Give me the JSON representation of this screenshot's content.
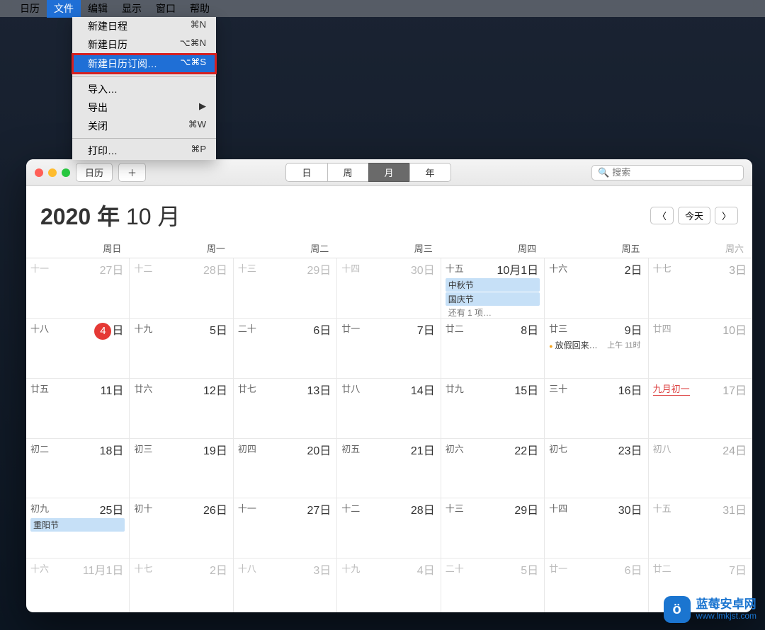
{
  "menubar": {
    "items": [
      "日历",
      "文件",
      "编辑",
      "显示",
      "窗口",
      "帮助"
    ],
    "active_index": 1
  },
  "dropdown": {
    "items": [
      {
        "label": "新建日程",
        "shortcut": "⌘N"
      },
      {
        "label": "新建日历",
        "shortcut": "⌥⌘N"
      },
      {
        "label": "新建日历订阅…",
        "shortcut": "⌥⌘S",
        "highlight": true
      },
      {
        "sep": true
      },
      {
        "label": "导入…",
        "shortcut": ""
      },
      {
        "label": "导出",
        "shortcut": "",
        "submenu": true
      },
      {
        "label": "关闭",
        "shortcut": "⌘W"
      },
      {
        "sep": true
      },
      {
        "label": "打印…",
        "shortcut": "⌘P"
      }
    ]
  },
  "toolbar": {
    "calendars_btn": "日历",
    "add_btn": "＋",
    "views": [
      "日",
      "周",
      "月",
      "年"
    ],
    "view_active": 2,
    "search_placeholder": "搜索"
  },
  "header": {
    "year": "2020 年",
    "month": "10 月",
    "prev": "〈",
    "next": "〉",
    "today": "今天"
  },
  "weekdays": [
    "周日",
    "周一",
    "周二",
    "周三",
    "周四",
    "周五",
    "周六"
  ],
  "cells": [
    {
      "lunar": "十一",
      "date": "27日",
      "dim": true
    },
    {
      "lunar": "十二",
      "date": "28日",
      "dim": true
    },
    {
      "lunar": "十三",
      "date": "29日",
      "dim": true
    },
    {
      "lunar": "十四",
      "date": "30日",
      "dim": true
    },
    {
      "lunar": "十五",
      "date": "10月1日",
      "events": [
        {
          "t": "中秋节"
        },
        {
          "t": "国庆节"
        }
      ],
      "more": "还有 1 项…"
    },
    {
      "lunar": "十六",
      "date": "2日"
    },
    {
      "lunar": "十七",
      "date": "3日"
    },
    {
      "lunar": "十八",
      "date": "日",
      "today": "4"
    },
    {
      "lunar": "十九",
      "date": "5日"
    },
    {
      "lunar": "二十",
      "date": "6日"
    },
    {
      "lunar": "廿一",
      "date": "7日"
    },
    {
      "lunar": "廿二",
      "date": "8日"
    },
    {
      "lunar": "廿三",
      "date": "9日",
      "events": [
        {
          "t": "放假回来…",
          "time": "上午 11时",
          "dot": true
        }
      ]
    },
    {
      "lunar": "廿四",
      "date": "10日"
    },
    {
      "lunar": "廿五",
      "date": "11日"
    },
    {
      "lunar": "廿六",
      "date": "12日"
    },
    {
      "lunar": "廿七",
      "date": "13日"
    },
    {
      "lunar": "廿八",
      "date": "14日"
    },
    {
      "lunar": "廿九",
      "date": "15日"
    },
    {
      "lunar": "三十",
      "date": "16日"
    },
    {
      "lunar": "九月初一",
      "date": "17日",
      "lunar_red": true
    },
    {
      "lunar": "初二",
      "date": "18日"
    },
    {
      "lunar": "初三",
      "date": "19日"
    },
    {
      "lunar": "初四",
      "date": "20日"
    },
    {
      "lunar": "初五",
      "date": "21日"
    },
    {
      "lunar": "初六",
      "date": "22日"
    },
    {
      "lunar": "初七",
      "date": "23日"
    },
    {
      "lunar": "初八",
      "date": "24日"
    },
    {
      "lunar": "初九",
      "date": "25日",
      "events": [
        {
          "t": "重阳节"
        }
      ]
    },
    {
      "lunar": "初十",
      "date": "26日"
    },
    {
      "lunar": "十一",
      "date": "27日"
    },
    {
      "lunar": "十二",
      "date": "28日"
    },
    {
      "lunar": "十三",
      "date": "29日"
    },
    {
      "lunar": "十四",
      "date": "30日"
    },
    {
      "lunar": "十五",
      "date": "31日"
    },
    {
      "lunar": "十六",
      "date": "11月1日",
      "dim": true
    },
    {
      "lunar": "十七",
      "date": "2日",
      "dim": true
    },
    {
      "lunar": "十八",
      "date": "3日",
      "dim": true
    },
    {
      "lunar": "十九",
      "date": "4日",
      "dim": true
    },
    {
      "lunar": "二十",
      "date": "5日",
      "dim": true
    },
    {
      "lunar": "廿一",
      "date": "6日",
      "dim": true
    },
    {
      "lunar": "廿二",
      "date": "7日",
      "dim": true
    }
  ],
  "watermark": {
    "site": "蓝莓安卓网",
    "url": "www.lmkjst.com",
    "glyph": "ö"
  }
}
